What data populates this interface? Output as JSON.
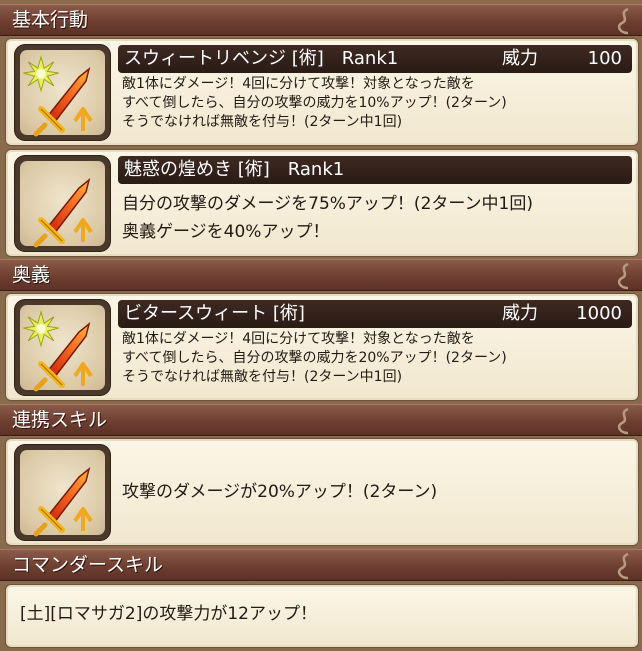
{
  "sections": {
    "basic": "基本行動",
    "ougi": "奥義",
    "renkei": "連携スキル",
    "commander": "コマンダースキル"
  },
  "skills": [
    {
      "name": "スウィートリベンジ [術]　Rank1",
      "power_label": "威力",
      "power_value": "100",
      "lines": [
        "敵1体にダメージ！4回に分けて攻撃！対象となった敵を",
        "すべて倒したら、自分の攻撃の威力を10%アップ！(2ターン)",
        "そうでなければ無敵を付与！(2ターン中1回)"
      ]
    },
    {
      "name": "魅惑の煌めき [術]　Rank1",
      "lines": [
        "自分の攻撃のダメージを75%アップ！(2ターン中1回)",
        "奥義ゲージを40%アップ！"
      ]
    },
    {
      "name": "ビタースウィート [術]",
      "power_label": "威力",
      "power_value": "1000",
      "lines": [
        "敵1体にダメージ！4回に分けて攻撃！対象となった敵を",
        "すべて倒したら、自分の攻撃の威力を20%アップ！(2ターン)",
        "そうでなければ無敵を付与！(2ターン中1回)"
      ]
    },
    {
      "lines": [
        "攻撃のダメージが20%アップ！(2ターン)"
      ]
    }
  ],
  "commander": {
    "text": "[土][ロマサガ2]の攻撃力が12アップ！"
  },
  "icons": [
    "sword-burst-icon",
    "sword-icon",
    "sword-burst-icon",
    "sword-icon"
  ],
  "colors": {
    "header": "#6e3f31",
    "card": "#f6efdc",
    "namebar": "#2f1f18",
    "sword": "#e8501c"
  }
}
